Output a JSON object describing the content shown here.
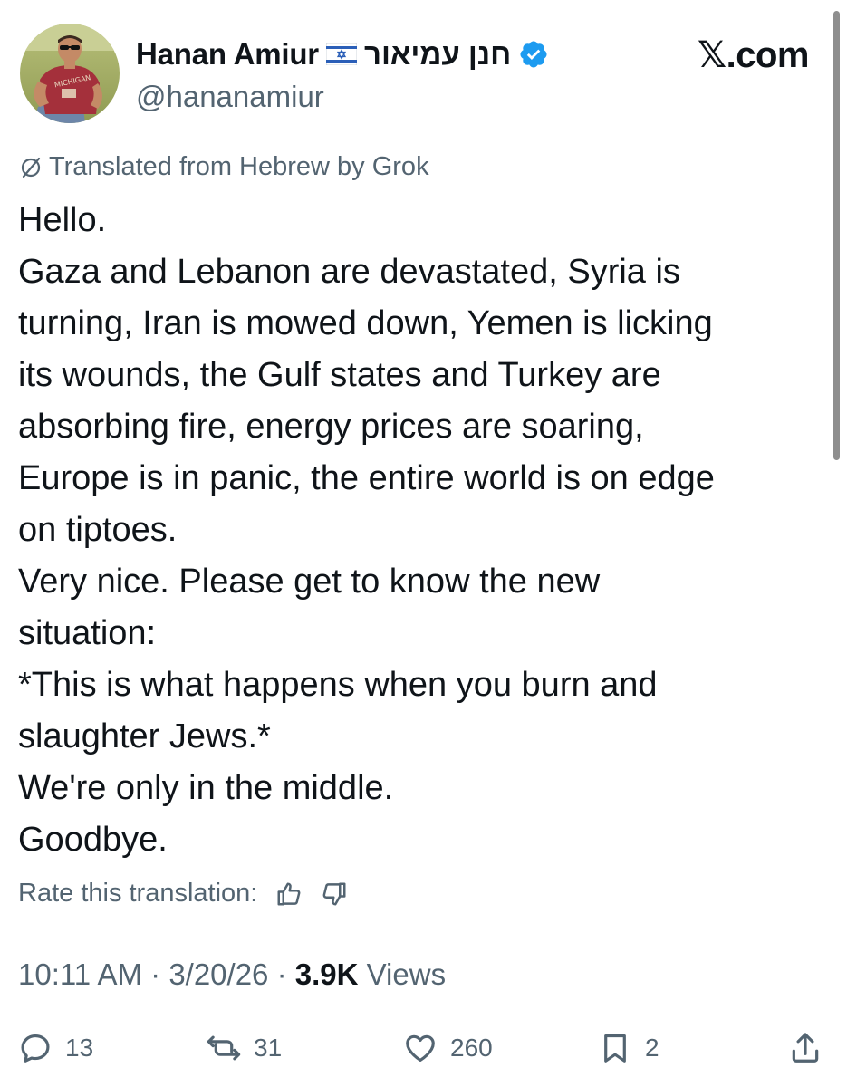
{
  "header": {
    "display_name": "Hanan Amiur",
    "flag_icon": "israel-flag-icon",
    "name_hebrew": "חנן עמיאור",
    "verified_icon": "verified-badge-icon",
    "verified_color": "#1d9bf0",
    "handle": "@hananamiur",
    "site_label": "𝕏.com",
    "avatar": {
      "shirt_text": "MICHIGAN"
    }
  },
  "translation": {
    "icon": "translate-icon",
    "note": "Translated from Hebrew by Grok"
  },
  "tweet": {
    "lines": [
      "Hello.",
      "Gaza and Lebanon are devastated, Syria is",
      "turning, Iran is mowed down, Yemen is licking",
      "its wounds, the Gulf states and Turkey are",
      "absorbing fire, energy prices are soaring,",
      "Europe is in panic, the entire world is on edge",
      "on tiptoes.",
      "Very nice. Please get to know the new",
      "situation:",
      "*This is what happens when you burn and",
      "slaughter Jews.*",
      "We're only in the middle.",
      "Goodbye."
    ]
  },
  "rating": {
    "label": "Rate this translation:",
    "up_icon": "thumbs-up-icon",
    "down_icon": "thumbs-down-icon"
  },
  "meta": {
    "time": "10:11 AM",
    "separator": " · ",
    "date": "3/20/26",
    "views_count": "3.9K",
    "views_label": "Views"
  },
  "actions": {
    "reply": {
      "icon": "reply-icon",
      "count": "13"
    },
    "repost": {
      "icon": "repost-icon",
      "count": "31"
    },
    "like": {
      "icon": "heart-icon",
      "count": "260"
    },
    "bookmark": {
      "icon": "bookmark-icon",
      "count": "2"
    },
    "share": {
      "icon": "share-icon"
    }
  },
  "colors": {
    "text_primary": "#0f1419",
    "text_secondary": "#536471",
    "brand_blue": "#1d9bf0"
  }
}
